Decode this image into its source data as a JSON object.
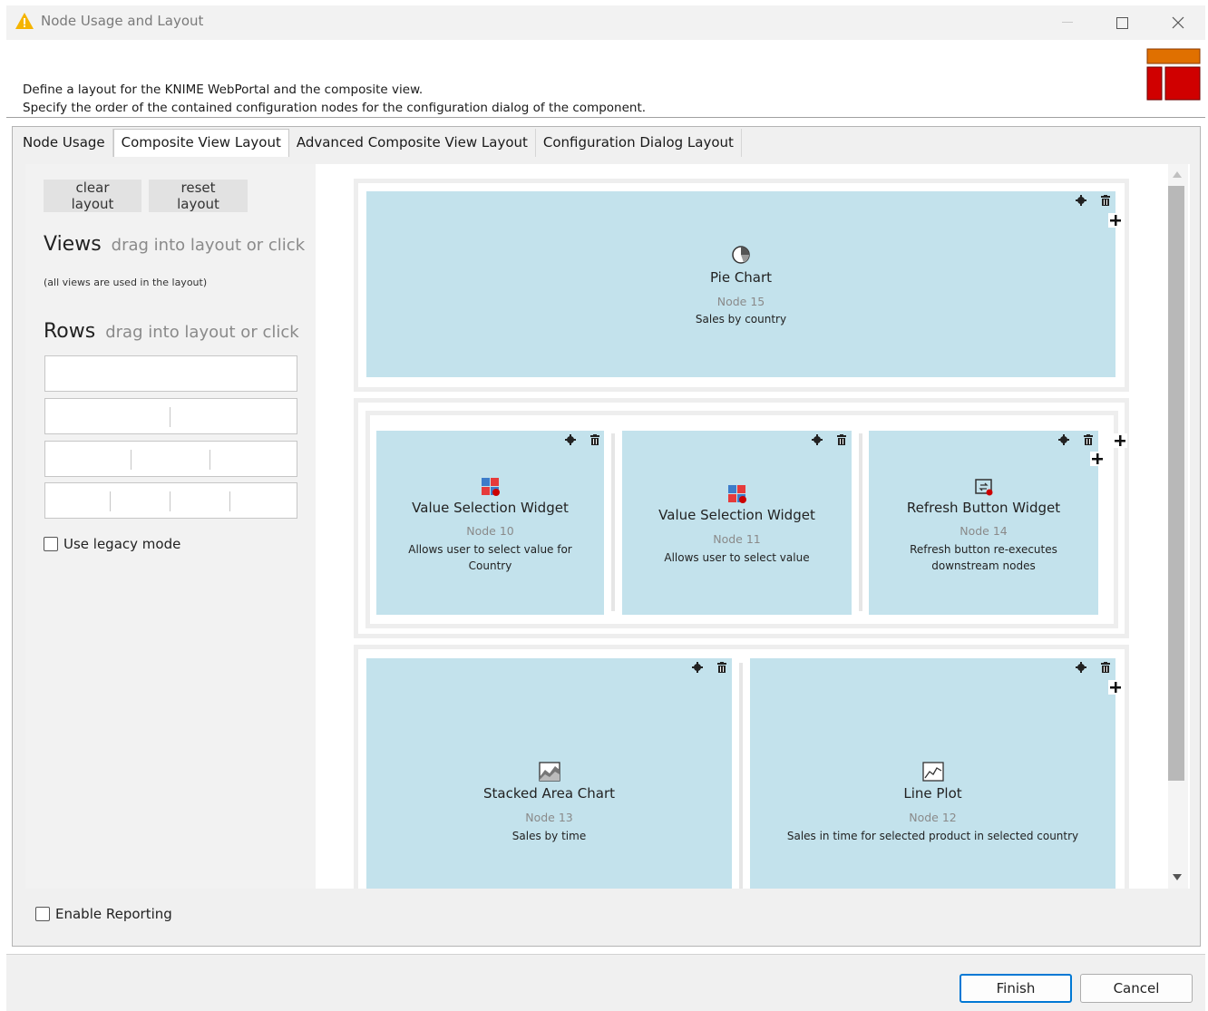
{
  "window": {
    "title": "Node Usage and Layout"
  },
  "description": {
    "line1": "Define a layout for the KNIME WebPortal and the composite view.",
    "line2": "Specify the order of the contained configuration nodes for the configuration dialog of the component."
  },
  "tabs": [
    {
      "label": "Node Usage",
      "active": false
    },
    {
      "label": "Composite View Layout",
      "active": true
    },
    {
      "label": "Advanced Composite View Layout",
      "active": false
    },
    {
      "label": "Configuration Dialog Layout",
      "active": false
    }
  ],
  "left": {
    "clear_layout": "clear layout",
    "reset_layout": "reset layout",
    "views_title": "Views",
    "views_hint": "drag into layout or click",
    "views_note": "(all views are used in the layout)",
    "rows_title": "Rows",
    "rows_hint": "drag into layout or click",
    "legacy_mode": "Use legacy mode",
    "legacy_checked": false
  },
  "layout": {
    "pie": {
      "title": "Pie Chart",
      "node": "Node 15",
      "desc": "Sales by country",
      "icon": "pie-chart-icon"
    },
    "vs10": {
      "title": "Value Selection Widget",
      "node": "Node 10",
      "desc": "Allows user to select value for Country",
      "icon": "value-selection-icon"
    },
    "vs11": {
      "title": "Value Selection Widget",
      "node": "Node 11",
      "desc": "Allows user to select value",
      "icon": "value-selection-icon"
    },
    "refresh": {
      "title": "Refresh Button Widget",
      "node": "Node 14",
      "desc": "Refresh button re-executes downstream nodes",
      "icon": "refresh-button-icon"
    },
    "stacked": {
      "title": "Stacked Area Chart",
      "node": "Node 13",
      "desc": "Sales by time",
      "icon": "stacked-area-chart-icon"
    },
    "line": {
      "title": "Line Plot",
      "node": "Node 12",
      "desc": "Sales in time for selected product in selected country",
      "icon": "line-plot-icon"
    }
  },
  "enable_reporting": "Enable Reporting",
  "reporting_checked": false,
  "footer": {
    "finish": "Finish",
    "cancel": "Cancel"
  },
  "colors": {
    "cell": "#c3e2ec",
    "accent": "#0078d4",
    "logo_orange": "#e07000",
    "logo_red": "#d00000"
  }
}
